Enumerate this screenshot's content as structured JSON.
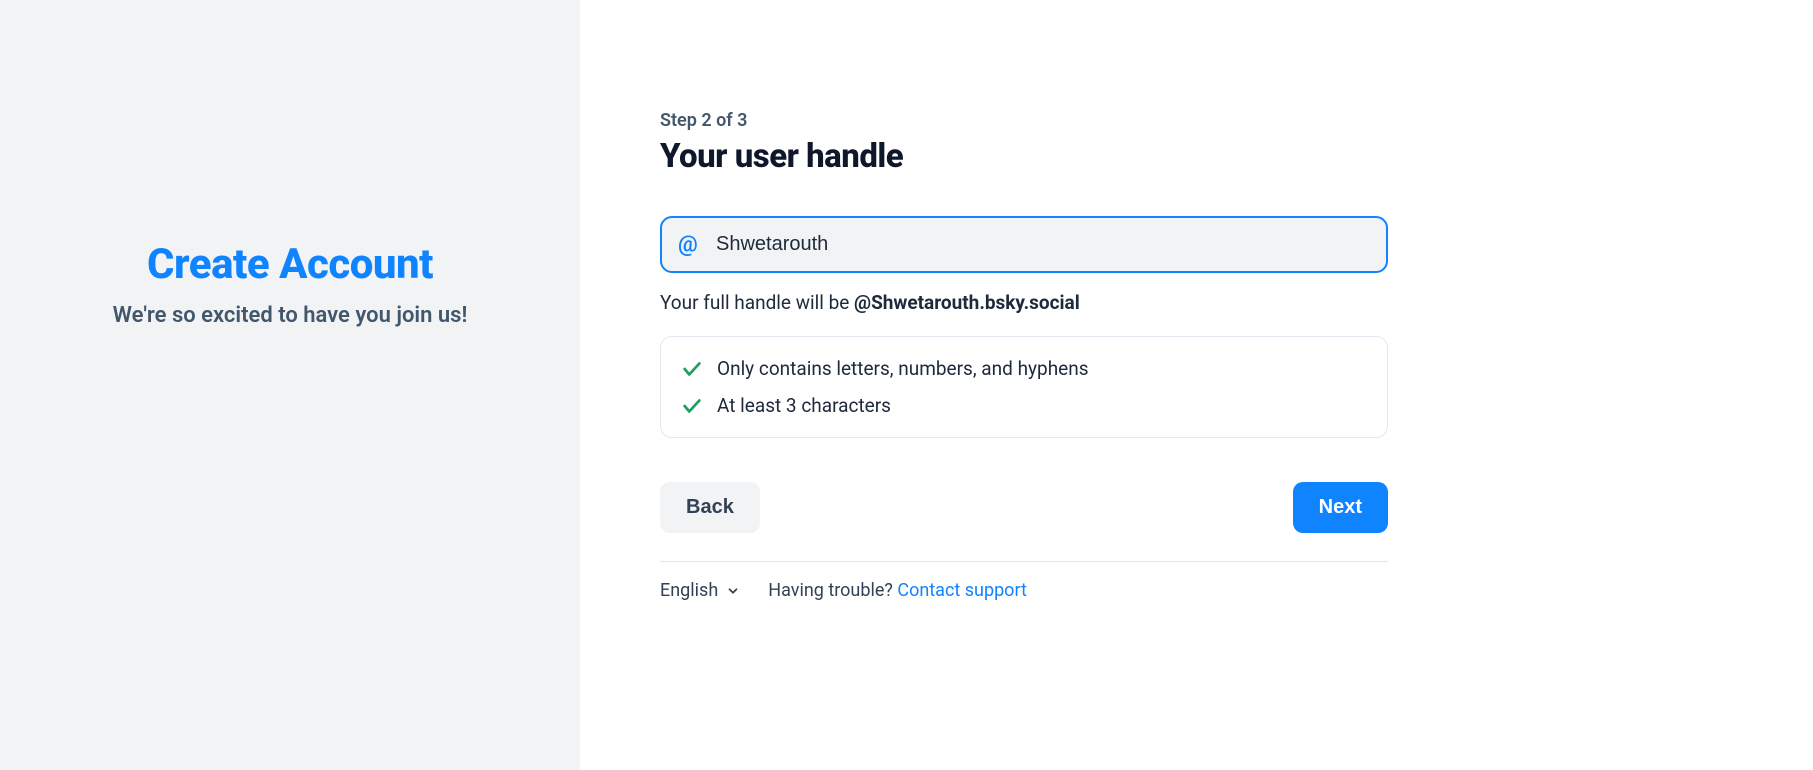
{
  "left": {
    "title": "Create Account",
    "subtitle": "We're so excited to have you join us!"
  },
  "form": {
    "step_label": "Step 2 of 3",
    "title": "Your user handle",
    "handle_value": "Shwetarouth",
    "full_handle_prefix": "Your full handle will be ",
    "full_handle_value": "@Shwetarouth.bsky.social",
    "validations": [
      "Only contains letters, numbers, and hyphens",
      "At least 3 characters"
    ],
    "back_label": "Back",
    "next_label": "Next"
  },
  "footer": {
    "language": "English",
    "trouble_text": "Having trouble? ",
    "support_link": "Contact support"
  }
}
